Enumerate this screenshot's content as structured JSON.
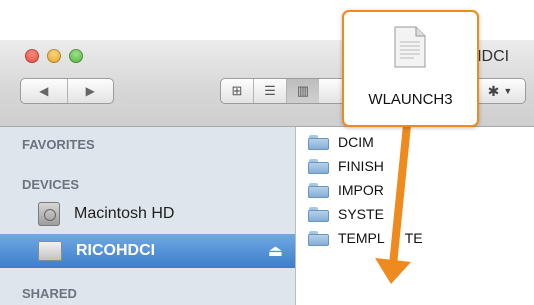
{
  "window": {
    "title": "HDCI"
  },
  "toolbar": {
    "back_icon": "◀",
    "forward_icon": "▶",
    "view_icons": [
      "⊞",
      "☰",
      "▥"
    ]
  },
  "sidebar": {
    "favorites_header": "FAVORITES",
    "devices_header": "DEVICES",
    "shared_header": "SHARED",
    "items": [
      {
        "label": "Macintosh HD",
        "icon": "hard-disk-icon"
      },
      {
        "label": "RICOHDCI",
        "icon": "external-drive-icon",
        "selected": true
      }
    ]
  },
  "content": {
    "files": [
      "DCIM",
      "FINISH",
      "IMPOR",
      "SYSTE",
      "TEMPL",
      "TE"
    ]
  },
  "drag_popup": {
    "label": "WLAUNCH3",
    "icon": "document-icon"
  },
  "colors": {
    "accent": "#ee8a1e",
    "selection": "#3d7dcb",
    "sidebar_bg": "#dfe5ec"
  }
}
